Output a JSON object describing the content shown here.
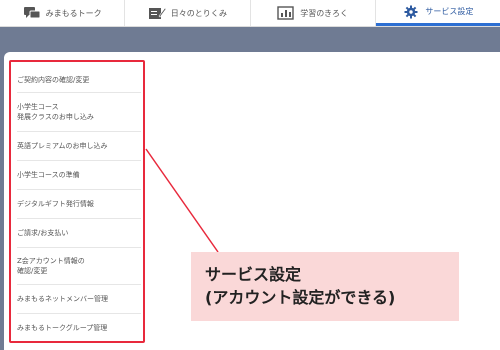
{
  "tabs": [
    {
      "label": "みまもるトーク",
      "icon": "chat-icon"
    },
    {
      "label": "日々のとりくみ",
      "icon": "pencil-note-icon"
    },
    {
      "label": "学習のきろく",
      "icon": "chart-icon"
    },
    {
      "label": "サービス設定",
      "icon": "gear-icon",
      "active": true
    }
  ],
  "menu": {
    "items": [
      {
        "line1": "ご契約内容の確認/変更",
        "line2": ""
      },
      {
        "line1": "小学生コース",
        "line2": "発展クラスのお申し込み"
      },
      {
        "line1": "英語プレミアムのお申し込み",
        "line2": ""
      },
      {
        "line1": "小学生コースの準備",
        "line2": ""
      },
      {
        "line1": "デジタルギフト発行情報",
        "line2": ""
      },
      {
        "line1": "ご請求/お支払い",
        "line2": ""
      },
      {
        "line1": "Z会アカウント情報の",
        "line2": "確認/変更"
      },
      {
        "line1": "みまもるネットメンバー管理",
        "line2": ""
      },
      {
        "line1": "みまもるトークグループ管理",
        "line2": ""
      }
    ]
  },
  "callout": {
    "line1": "サービス設定",
    "line2": "(アカウント設定ができる)"
  },
  "colors": {
    "highlight": "#e8293c",
    "active_tab": "#2d6fd2",
    "background": "#6f7b93",
    "callout_bg": "#fad8d8"
  }
}
